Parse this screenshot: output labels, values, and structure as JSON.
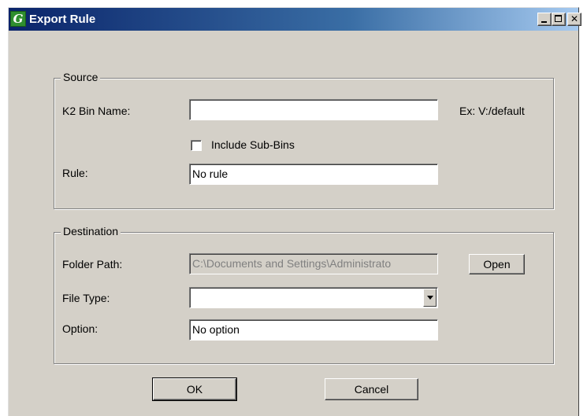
{
  "window": {
    "title": "Export Rule",
    "icon_letter": "G"
  },
  "source": {
    "title": "Source",
    "bin_name_label": "K2 Bin Name:",
    "bin_name_value": "",
    "example_text": "Ex: V:/default",
    "include_sub_bins_label": "Include Sub-Bins",
    "include_sub_bins_checked": false,
    "rule_label": "Rule:",
    "rule_value": "No rule"
  },
  "destination": {
    "title": "Destination",
    "folder_path_label": "Folder Path:",
    "folder_path_value": "C:\\Documents and Settings\\Administrato",
    "open_button": "Open",
    "file_type_label": "File Type:",
    "file_type_value": "",
    "option_label": "Option:",
    "option_value": "No option"
  },
  "buttons": {
    "ok": "OK",
    "cancel": "Cancel"
  }
}
